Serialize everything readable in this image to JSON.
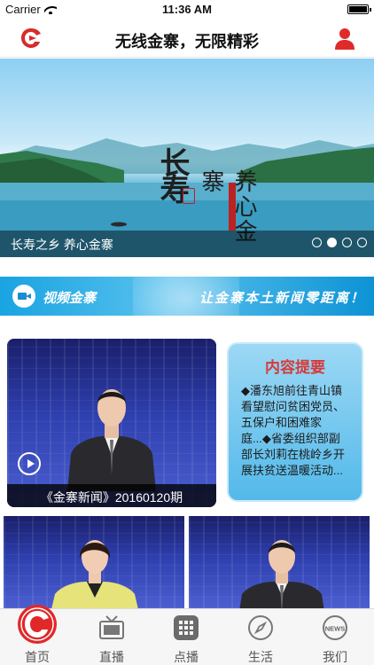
{
  "status_bar": {
    "carrier": "Carrier",
    "time": "11:36 AM"
  },
  "nav": {
    "title": "无线金寨，无限精彩"
  },
  "banner": {
    "caption": "长寿之乡 养心金寨",
    "calligraphy_main": "长寿",
    "calligraphy_sub": "养心金寨",
    "slide_count": 4,
    "active_slide": 2
  },
  "video_section": {
    "title": "视频金寨",
    "slogan": "让金寨本土新闻零距离！"
  },
  "featured": {
    "caption": "《金寨新闻》20160120期"
  },
  "summary": {
    "title": "内容提要",
    "text": "◆潘东旭前往青山镇看望慰问贫困党员、五保户和困难家庭...◆省委组织部副部长刘莉在桃岭乡开展扶贫送温暖活动..."
  },
  "tabs": [
    {
      "label": "首页",
      "icon": "home-logo-icon"
    },
    {
      "label": "直播",
      "icon": "tv-icon"
    },
    {
      "label": "点播",
      "icon": "grid-icon"
    },
    {
      "label": "生活",
      "icon": "compass-icon"
    },
    {
      "label": "我们",
      "icon": "news-icon"
    }
  ],
  "colors": {
    "brand_red": "#d92b2b",
    "band_blue": "#19a4e2",
    "summary_title": "#d63a3a"
  }
}
